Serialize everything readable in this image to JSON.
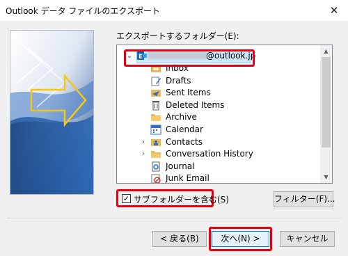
{
  "window": {
    "title": "Outlook データ ファイルのエクスポート",
    "close_glyph": "✕"
  },
  "export_label": "エクスポートするフォルダー(E):",
  "tree": {
    "root_label": "@outlook.jp",
    "items": [
      {
        "label": "Inbox",
        "icon": "inbox-icon",
        "expandable": false
      },
      {
        "label": "Drafts",
        "icon": "drafts-icon",
        "expandable": false
      },
      {
        "label": "Sent Items",
        "icon": "sent-items-icon",
        "expandable": false
      },
      {
        "label": "Deleted Items",
        "icon": "trash-icon",
        "expandable": false
      },
      {
        "label": "Archive",
        "icon": "folder-icon",
        "expandable": false
      },
      {
        "label": "Calendar",
        "icon": "calendar-icon",
        "expandable": false
      },
      {
        "label": "Contacts",
        "icon": "contacts-icon",
        "expandable": true
      },
      {
        "label": "Conversation History",
        "icon": "folder-icon",
        "expandable": true
      },
      {
        "label": "Journal",
        "icon": "journal-icon",
        "expandable": false
      },
      {
        "label": "Junk Email",
        "icon": "junk-icon",
        "expandable": false
      }
    ]
  },
  "subfolders": {
    "label": "サブフォルダーを含む(S)",
    "checked": true,
    "check_glyph": "✓"
  },
  "buttons": {
    "filter": "フィルター(F)...",
    "back": "< 戻る(B)",
    "next": "次へ(N) >",
    "cancel": "キャンセル"
  },
  "colors": {
    "highlight": "#e60012",
    "selection": "#cce8ff",
    "accent": "#0078d7"
  }
}
